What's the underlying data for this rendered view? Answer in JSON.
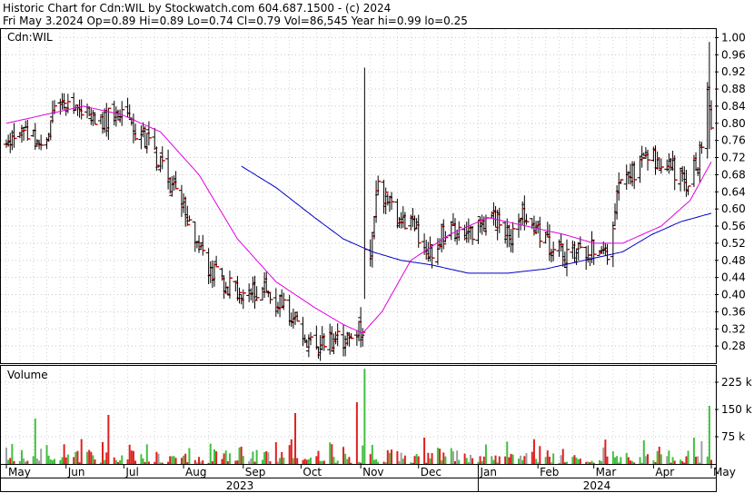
{
  "header": {
    "line1": "Historic Chart for Cdn:WIL by Stockwatch.com 604.687.1500 - (c) 2024",
    "line2": "Fri May  3.2024   Op=0.89  Hi=0.89  Lo=0.74  Cl=0.79  Vol=86,545  Year hi=0.99  lo=0.25"
  },
  "chart_data": [
    {
      "type": "ohlc",
      "label": "Cdn:WIL",
      "ylim": [
        0.24,
        1.02
      ],
      "yticks": [
        "1.00",
        "0.96",
        "0.92",
        "0.88",
        "0.84",
        "0.80",
        "0.76",
        "0.72",
        "0.68",
        "0.64",
        "0.60",
        "0.56",
        "0.52",
        "0.48",
        "0.44",
        "0.40",
        "0.36",
        "0.32",
        "0.28"
      ],
      "grid": true,
      "x_months": [
        "May",
        "Jun",
        "Jul",
        "Aug",
        "Sep",
        "Oct",
        "Nov",
        "Dec",
        "Jan",
        "Feb",
        "Mar",
        "Apr",
        "May"
      ],
      "x_years": [
        "2023",
        "2024"
      ],
      "month_start_day": [
        0,
        31,
        61,
        92,
        123,
        153,
        184,
        214,
        245,
        276,
        305,
        336,
        366
      ],
      "price_path": {
        "day": [
          0,
          10,
          20,
          28,
          35,
          45,
          55,
          65,
          75,
          85,
          95,
          105,
          115,
          125,
          135,
          145,
          150,
          153,
          160,
          165,
          172,
          180,
          185,
          186,
          188,
          192,
          198,
          205,
          212,
          220,
          230,
          245,
          255,
          262,
          270,
          280,
          290,
          300,
          305,
          310,
          312,
          315,
          320,
          325,
          330,
          336,
          345,
          352,
          355,
          360,
          364,
          366
        ],
        "close": [
          0.75,
          0.78,
          0.76,
          0.86,
          0.84,
          0.8,
          0.82,
          0.8,
          0.74,
          0.66,
          0.58,
          0.46,
          0.42,
          0.4,
          0.42,
          0.36,
          0.33,
          0.31,
          0.27,
          0.28,
          0.29,
          0.3,
          0.33,
          0.52,
          0.44,
          0.65,
          0.62,
          0.58,
          0.55,
          0.5,
          0.56,
          0.55,
          0.58,
          0.54,
          0.59,
          0.53,
          0.49,
          0.5,
          0.51,
          0.49,
          0.48,
          0.55,
          0.72,
          0.68,
          0.7,
          0.72,
          0.7,
          0.66,
          0.68,
          0.72,
          0.88,
          0.79
        ]
      },
      "events": [
        {
          "day": 186,
          "high": 0.93,
          "low": 0.39
        },
        {
          "day": 365,
          "high": 0.99,
          "low": 0.74
        }
      ],
      "moving_averages": [
        {
          "color": "#e000e0",
          "day": [
            0,
            40,
            60,
            80,
            100,
            120,
            140,
            160,
            175,
            185,
            195,
            210,
            230,
            250,
            270,
            290,
            305,
            320,
            340,
            355,
            366
          ],
          "value": [
            0.8,
            0.84,
            0.82,
            0.78,
            0.68,
            0.53,
            0.43,
            0.37,
            0.33,
            0.31,
            0.36,
            0.48,
            0.54,
            0.58,
            0.56,
            0.54,
            0.52,
            0.52,
            0.56,
            0.62,
            0.71
          ]
        },
        {
          "color": "#0000c0",
          "day": [
            122,
            140,
            160,
            175,
            190,
            205,
            220,
            240,
            260,
            280,
            300,
            320,
            335,
            350,
            366
          ],
          "value": [
            0.7,
            0.65,
            0.58,
            0.53,
            0.5,
            0.48,
            0.47,
            0.45,
            0.45,
            0.46,
            0.48,
            0.5,
            0.54,
            0.57,
            0.59
          ]
        }
      ]
    },
    {
      "type": "bar",
      "label": "Volume",
      "ylim": [
        0,
        270
      ],
      "yticks": [
        "225 k",
        "150 k",
        "75 k"
      ],
      "spikes": [
        {
          "day": 186,
          "value": 262,
          "color": "#40c040"
        },
        {
          "day": 365,
          "value": 160,
          "color": "#40c040"
        },
        {
          "day": 182,
          "value": 170,
          "color": "#e02020"
        },
        {
          "day": 110,
          "value": 148,
          "color": "#e02020"
        },
        {
          "day": 150,
          "value": 140,
          "color": "#e02020"
        },
        {
          "day": 53,
          "value": 135,
          "color": "#e02020"
        },
        {
          "day": 15,
          "value": 125,
          "color": "#40c040"
        }
      ],
      "colors": {
        "up": "#40c040",
        "down": "#e02020",
        "flat": "#a0a0a0"
      }
    }
  ]
}
